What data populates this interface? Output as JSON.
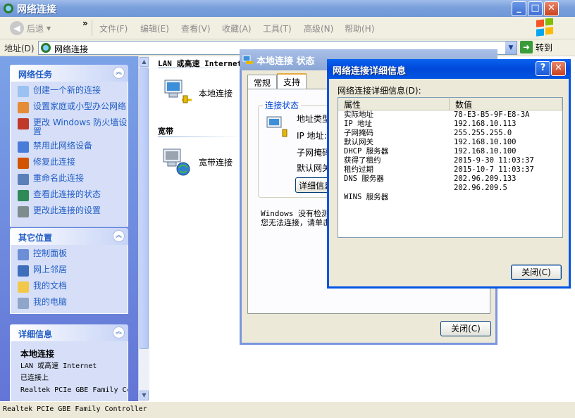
{
  "window": {
    "title": "网络连接"
  },
  "menubar": {
    "back_label": "后退",
    "chevron": "»",
    "menus": [
      "文件(F)",
      "编辑(E)",
      "查看(V)",
      "收藏(A)",
      "工具(T)",
      "高级(N)",
      "帮助(H)"
    ]
  },
  "address": {
    "label": "地址(D)",
    "value": "网络连接",
    "go_label": "转到"
  },
  "taskpane": {
    "network_tasks": {
      "title": "网络任务",
      "items": [
        "创建一个新的连接",
        "设置家庭或小型办公网络",
        "更改 Windows 防火墙设置",
        "禁用此网络设备",
        "修复此连接",
        "重命名此连接",
        "查看此连接的状态",
        "更改此连接的设置"
      ]
    },
    "other_places": {
      "title": "其它位置",
      "items": [
        "控制面板",
        "网上邻居",
        "我的文档",
        "我的电脑"
      ]
    },
    "details": {
      "title": "详细信息",
      "name": "本地连接",
      "type": "LAN 或高速 Internet",
      "state": "已连接上",
      "device": "Realtek PCIe GBE Family Controller"
    }
  },
  "content": {
    "group_lan": "LAN 或高速 Internet",
    "lan_item": "本地连接",
    "group_broadband": "宽带",
    "broadband_item": "宽带连接"
  },
  "statusbar": {
    "text": "Realtek PCIe GBE Family Controller"
  },
  "status_dialog": {
    "title": "本地连接 状态",
    "tabs": [
      "常规",
      "支持"
    ],
    "group_title": "连接状态",
    "rows": [
      "地址类型:",
      "IP 地址:",
      "子网掩码:",
      "默认网关:"
    ],
    "details_button": "详细信息(E)...",
    "note_line1": "Windows 没有检测到此连接的问题。",
    "note_line2": "您无法连接，请单击\"修复\"。",
    "close_button": "关闭(C)"
  },
  "details_dialog": {
    "title": "网络连接详细信息",
    "help": "?",
    "label": "网络连接详细信息(D):",
    "col_property": "属性",
    "col_value": "数值",
    "rows": [
      {
        "property": "实际地址",
        "value": "78-E3-B5-9F-E8-3A"
      },
      {
        "property": "IP 地址",
        "value": "192.168.10.113"
      },
      {
        "property": "子网掩码",
        "value": "255.255.255.0"
      },
      {
        "property": "默认网关",
        "value": "192.168.10.100"
      },
      {
        "property": "DHCP 服务器",
        "value": "192.168.10.100"
      },
      {
        "property": "获得了租约",
        "value": "2015-9-30 11:03:37"
      },
      {
        "property": "租约过期",
        "value": "2015-10-7 11:03:37"
      },
      {
        "property": "DNS 服务器",
        "value": "202.96.209.133"
      },
      {
        "property": "",
        "value": "202.96.209.5"
      },
      {
        "property": "WINS 服务器",
        "value": ""
      }
    ],
    "close_button": "关闭(C)"
  },
  "icons": {
    "window": "network-connections-icon",
    "lan": "lan-connection-icon",
    "broadband": "broadband-connection-icon"
  }
}
